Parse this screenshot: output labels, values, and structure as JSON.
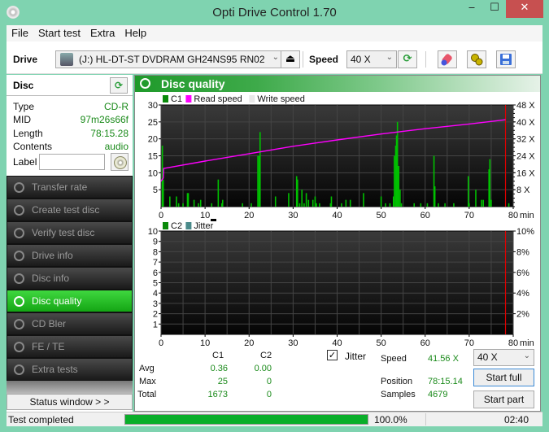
{
  "window": {
    "title": "Opti Drive Control 1.70",
    "minimize": "‒",
    "maximize": "☐",
    "close": "✕"
  },
  "menu": [
    "File",
    "Start test",
    "Extra",
    "Help"
  ],
  "toolbar": {
    "drive_label": "Drive",
    "drive_value": "(J:)   HL-DT-ST DVDRAM GH24NS95 RN02",
    "speed_label": "Speed",
    "speed_value": "40 X",
    "eject_glyph": "⏏",
    "refresh_glyph": "⟳",
    "chevron": "⌄"
  },
  "disc": {
    "header": "Disc",
    "fields": [
      {
        "key": "Type",
        "value": "CD-R"
      },
      {
        "key": "MID",
        "value": "97m26s66f"
      },
      {
        "key": "Length",
        "value": "78:15.28"
      },
      {
        "key": "Contents",
        "value": "audio"
      }
    ],
    "label_key": "Label",
    "label_value": ""
  },
  "nav": [
    {
      "label": "Transfer rate",
      "active": false
    },
    {
      "label": "Create test disc",
      "active": false
    },
    {
      "label": "Verify test disc",
      "active": false
    },
    {
      "label": "Drive info",
      "active": false
    },
    {
      "label": "Disc info",
      "active": false
    },
    {
      "label": "Disc quality",
      "active": true
    },
    {
      "label": "CD Bler",
      "active": false
    },
    {
      "label": "FE / TE",
      "active": false
    },
    {
      "label": "Extra tests",
      "active": false
    }
  ],
  "status_window_button": "Status window > >",
  "panel": {
    "title": "Disc quality"
  },
  "stats": {
    "col_c1": "C1",
    "col_c2": "C2",
    "rows": [
      {
        "label": "Avg",
        "c1": "0.36",
        "c2": "0.00"
      },
      {
        "label": "Max",
        "c1": "25",
        "c2": "0"
      },
      {
        "label": "Total",
        "c1": "1673",
        "c2": "0"
      }
    ],
    "jitter_label": "Jitter",
    "jitter_checked": true,
    "speed_label": "Speed",
    "speed_value": "41.56 X",
    "position_label": "Position",
    "position_value": "78:15.14",
    "samples_label": "Samples",
    "samples_value": "4679",
    "speed_select": "40 X",
    "start_full": "Start full",
    "start_part": "Start part"
  },
  "statusbar": {
    "text": "Test completed",
    "progress_percent": 100,
    "progress_text": "100.0%",
    "time": "02:40"
  },
  "chart_data": [
    {
      "type": "bar",
      "title": "",
      "legend": [
        "C1",
        "Read speed",
        "Write speed"
      ],
      "legend_colors": [
        "#0a8a0a",
        "#ff00ff",
        "#e8e8e8"
      ],
      "xlabel": "min",
      "xlim": [
        0,
        80
      ],
      "xticks": [
        0,
        10,
        20,
        30,
        40,
        50,
        60,
        70,
        80
      ],
      "ylim": [
        0,
        30
      ],
      "yticks": [
        5,
        10,
        15,
        20,
        25,
        30
      ],
      "y2lim": [
        0,
        48
      ],
      "y2ticks": [
        "8 X",
        "16 X",
        "24 X",
        "32 X",
        "40 X",
        "48 X"
      ],
      "end_marker_min": 78.25,
      "c1_series": {
        "name": "C1",
        "x": [
          0.3,
          0.5,
          2,
          3.5,
          4,
          5,
          6,
          6.2,
          7.5,
          8.5,
          9,
          11.5,
          13,
          13.8,
          14,
          18.5,
          20.5,
          22,
          22.3,
          22.5,
          26,
          29,
          30.8,
          31,
          31.5,
          32,
          32.5,
          33,
          33.5,
          34.5,
          35,
          35.3,
          36,
          38.5,
          38.7,
          41,
          42,
          43,
          46,
          50,
          51,
          52,
          52.8,
          53,
          53.3,
          53.5,
          53.7,
          54,
          54.3,
          54.6,
          57.5,
          59,
          60.5,
          62,
          62.2,
          63,
          64.5,
          66.5,
          69.8,
          70,
          71.5,
          72.8,
          73.2,
          74.5,
          74.7,
          75,
          79
        ],
        "y": [
          18,
          8,
          3,
          3,
          1,
          1,
          4,
          4,
          2,
          1,
          2,
          1,
          8,
          1,
          2,
          1,
          1,
          15,
          15,
          22,
          3,
          4,
          9,
          8,
          1,
          5,
          1,
          4,
          2,
          2,
          3,
          1,
          1,
          1,
          3,
          1,
          2,
          2,
          4,
          3,
          1,
          1,
          3,
          15,
          18,
          21,
          25,
          12,
          5,
          1,
          1,
          1,
          1,
          15,
          6,
          1,
          1,
          1,
          9,
          1,
          5,
          2,
          2,
          11,
          14,
          2,
          1
        ]
      },
      "read_speed_series": {
        "name": "Read speed",
        "unit": "X",
        "x": [
          0,
          0.5,
          0.6,
          10,
          20,
          30,
          40,
          50,
          60,
          70,
          78.25
        ],
        "y": [
          12,
          13.5,
          18,
          21.5,
          25,
          28.5,
          31.5,
          34.3,
          36.8,
          39,
          41
        ]
      }
    },
    {
      "type": "bar",
      "legend": [
        "C2",
        "Jitter"
      ],
      "legend_colors": [
        "#0a8a0a",
        "#4a8a8a"
      ],
      "xlabel": "min",
      "xlim": [
        0,
        80
      ],
      "xticks": [
        0,
        10,
        20,
        30,
        40,
        50,
        60,
        70,
        80
      ],
      "ylim": [
        0,
        10
      ],
      "yticks": [
        1,
        2,
        3,
        4,
        5,
        6,
        7,
        8,
        9,
        10
      ],
      "y2ticks": [
        "2%",
        "4%",
        "6%",
        "8%",
        "10%"
      ],
      "end_marker_min": 78.25,
      "c2_series": {
        "name": "C2",
        "x": [],
        "y": []
      }
    }
  ]
}
